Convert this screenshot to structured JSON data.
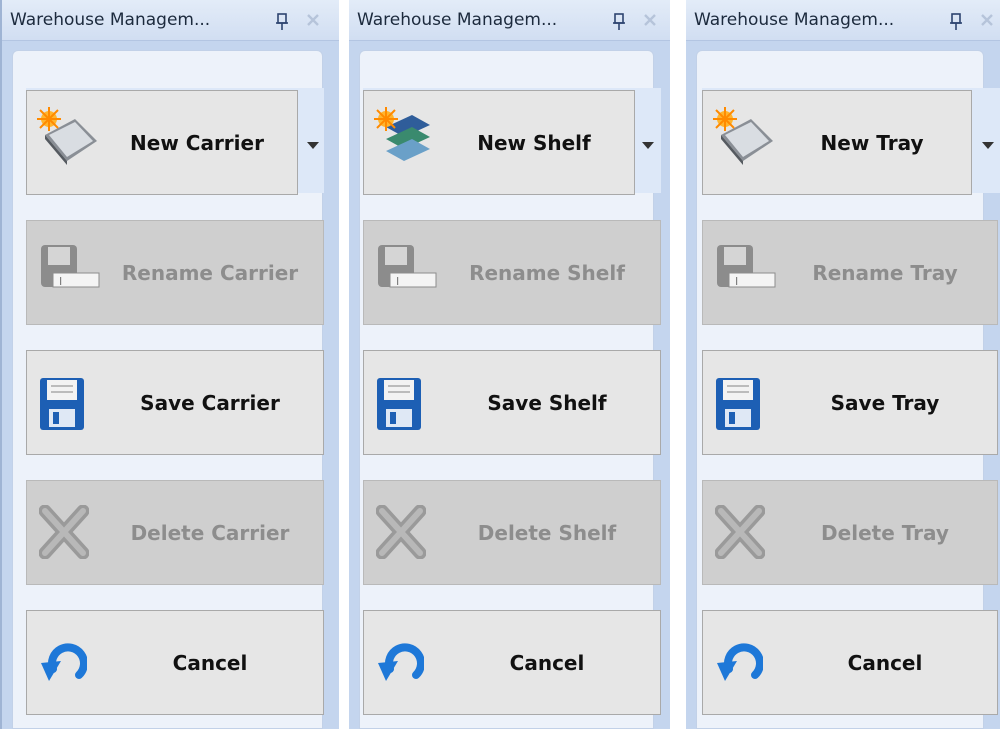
{
  "panels": [
    {
      "title": "Warehouse Managem...",
      "buttons": {
        "new": "New Carrier",
        "rename": "Rename Carrier",
        "save": "Save Carrier",
        "delete": "Delete Carrier",
        "cancel": "Cancel"
      }
    },
    {
      "title": "Warehouse Managem...",
      "buttons": {
        "new": "New Shelf",
        "rename": "Rename Shelf",
        "save": "Save Shelf",
        "delete": "Delete Shelf",
        "cancel": "Cancel"
      }
    },
    {
      "title": "Warehouse Managem...",
      "buttons": {
        "new": "New Tray",
        "rename": "Rename Tray",
        "save": "Save Tray",
        "delete": "Delete Tray",
        "cancel": "Cancel"
      }
    }
  ],
  "icons": {
    "pin": "pin-icon",
    "close": "close-icon",
    "new_item": "new-item-icon",
    "rename": "rename-disk-icon",
    "save": "floppy-disk-icon",
    "delete": "delete-x-icon",
    "cancel": "undo-arrow-icon",
    "dropdown": "chevron-down-icon"
  },
  "colors": {
    "panel_bg": "#c4d5ee",
    "button_bg": "#e6e6e6",
    "disabled_bg": "#cfcfcf",
    "disabled_text": "#8d8d8d"
  }
}
